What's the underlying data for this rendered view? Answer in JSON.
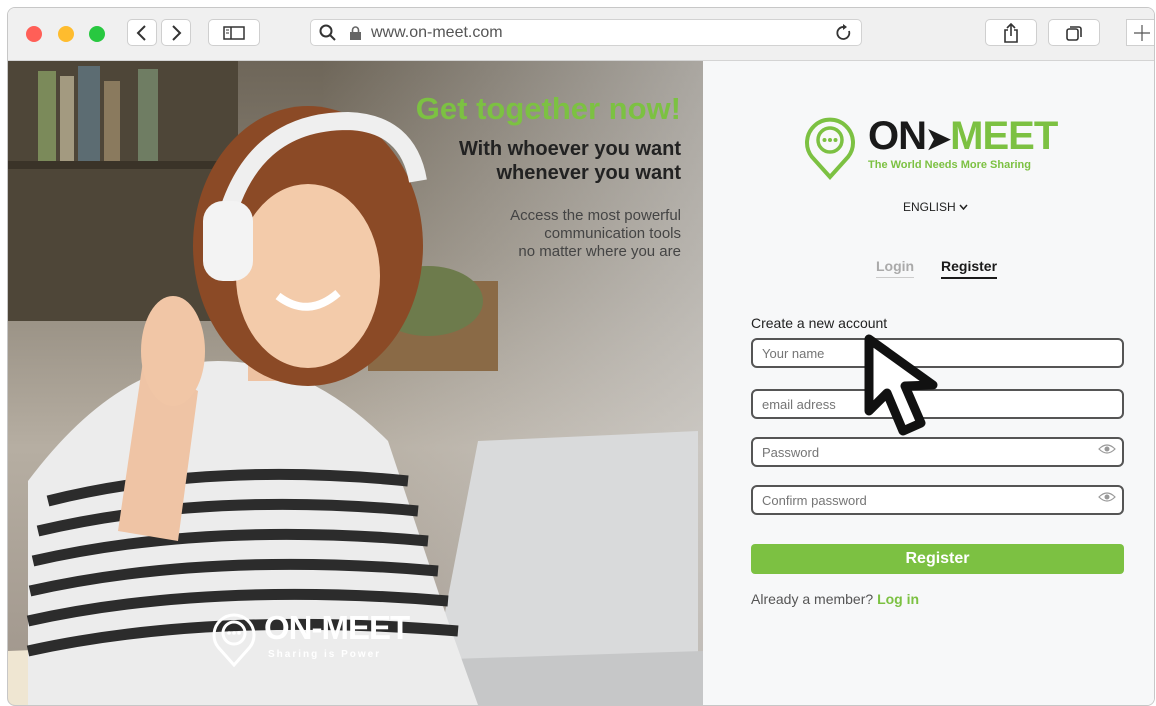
{
  "browser": {
    "url": "www.on-meet.com",
    "traffic_lights": {
      "red": "#ff5f57",
      "yellow": "#febc2e",
      "green": "#28c840"
    },
    "icons": [
      "back-icon",
      "forward-icon",
      "sidebar-icon",
      "search-icon",
      "lock-icon",
      "reload-icon",
      "share-icon",
      "tabs-icon",
      "new-tab-icon"
    ]
  },
  "hero": {
    "headline": "Get together now!",
    "tagline_line1": "With whoever you want",
    "tagline_line2": "whenever you want",
    "sub_line1": "Access the most powerful",
    "sub_line2": "communication tools",
    "sub_line3": "no matter where you are",
    "watermark_logo_text": "ON-MEET",
    "watermark_slogan": "Sharing is Power"
  },
  "brand": {
    "logo_on": "ON",
    "logo_meet": "MEET",
    "slogan": "The World Needs More Sharing",
    "accent_color": "#7cc142",
    "dark_color": "#1a1a1a"
  },
  "language": {
    "selected": "ENGLISH"
  },
  "tabs": {
    "login": "Login",
    "register": "Register",
    "active": "Register"
  },
  "form": {
    "heading": "Create a new account",
    "name_placeholder": "Your name",
    "email_placeholder": "email adress",
    "password_placeholder": "Password",
    "confirm_placeholder": "Confirm password",
    "submit_label": "Register"
  },
  "footer": {
    "prompt": "Already a member?",
    "login_link": "Log in"
  }
}
